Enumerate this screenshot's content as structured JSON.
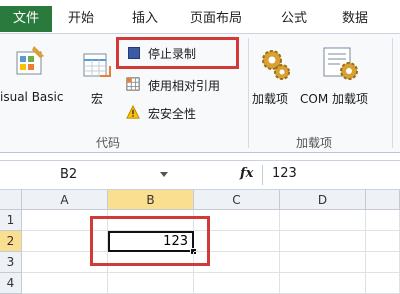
{
  "tabs": [
    "文件",
    "开始",
    "插入",
    "页面布局",
    "公式",
    "数据"
  ],
  "ribbon": {
    "visual_basic_label": "isual Basic",
    "macros_label": "宏",
    "stop_recording": "停止录制",
    "relative_refs": "使用相对引用",
    "macro_security": "宏安全性",
    "code_group": "代码",
    "addins_label": "加载项",
    "com_addins_label": "COM 加载项",
    "addins_group": "加载项"
  },
  "formula_bar": {
    "name_box": "B2",
    "fx": "fx",
    "value": "123"
  },
  "grid": {
    "columns": [
      "A",
      "B",
      "C",
      "D"
    ],
    "rows": [
      "1",
      "2",
      "3",
      "4"
    ],
    "b2_value": "123"
  },
  "colors": {
    "file_tab": "#2b7a3d",
    "highlight": "#d23a3a",
    "selected_header": "#fbdf91"
  }
}
